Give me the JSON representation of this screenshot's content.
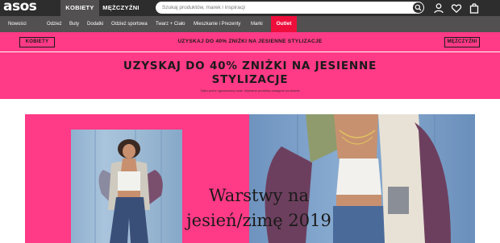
{
  "header": {
    "logo": "asos",
    "tabs": [
      {
        "label": "KOBIETY"
      },
      {
        "label": "MĘŻCZYŹNI"
      }
    ],
    "search": {
      "placeholder": "Szukaj produktów, marek i inspiracji"
    },
    "icons": [
      "search-icon",
      "account-icon",
      "heart-icon",
      "bag-icon"
    ]
  },
  "nav": {
    "items": [
      {
        "label": "Nowości"
      },
      {
        "label": "Odzież"
      },
      {
        "label": "Buty"
      },
      {
        "label": "Dodatki"
      },
      {
        "label": "Odzież sportowa"
      },
      {
        "label": "Twarz + Ciało"
      },
      {
        "label": "Mieszkanie i Prezenty"
      },
      {
        "label": "Marki"
      }
    ],
    "outlet": "Outlet"
  },
  "promo_strip": {
    "left_button": "KOBIETY",
    "text": "UZYSKAJ DO 40% ZNIŻKI NA JESIENNE STYLIZACJE",
    "right_button": "MĘŻCZYŹNI"
  },
  "banner": {
    "title_line1": "UZYSKAJ DO 40% ZNIŻKI NA JESIENNE",
    "title_line2": "STYLIZACJE",
    "subtext": "Tylko przez ograniczony czas. Wybrane produkty dostępne na stronie"
  },
  "hero": {
    "line1": "Warstwy na",
    "line2": "jesień/zimę 2019"
  },
  "colors": {
    "topbar": "#2d2d2d",
    "navbar": "#525050",
    "pink": "#ff3a86",
    "outlet": "#ee0e3c"
  }
}
